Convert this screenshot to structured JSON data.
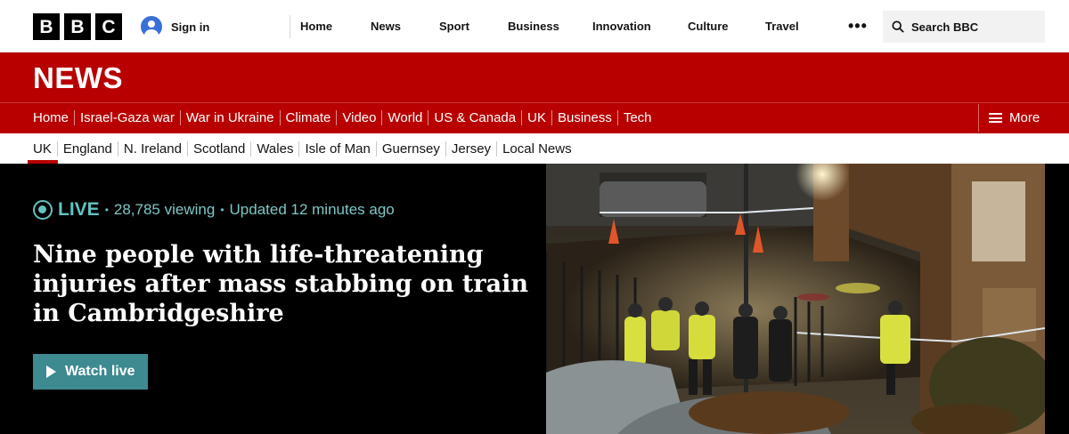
{
  "header": {
    "logo": [
      "B",
      "B",
      "C"
    ],
    "sign_in": "Sign in",
    "nav": [
      "Home",
      "News",
      "Sport",
      "Business",
      "Innovation",
      "Culture",
      "Travel"
    ],
    "more_dots": "•••",
    "search_label": "Search BBC"
  },
  "section": {
    "brand": "NEWS",
    "nav": [
      "Home",
      "Israel-Gaza war",
      "War in Ukraine",
      "Climate",
      "Video",
      "World",
      "US & Canada",
      "UK",
      "Business",
      "Tech"
    ],
    "active": "UK",
    "more_label": "More"
  },
  "subnav": {
    "items": [
      "UK",
      "England",
      "N. Ireland",
      "Scotland",
      "Wales",
      "Isle of Man",
      "Guernsey",
      "Jersey",
      "Local News"
    ],
    "active": "UK"
  },
  "hero": {
    "live_label": "LIVE",
    "viewing": "28,785 viewing",
    "updated": "Updated 12 minutes ago",
    "headline": "Nine people with life-threatening injuries after mass stabbing on train in Cambridgeshire",
    "watch_label": "Watch live"
  },
  "colors": {
    "brand_red": "#b80000",
    "live_teal": "#62c3c1",
    "watch_button": "#3d8a90"
  }
}
